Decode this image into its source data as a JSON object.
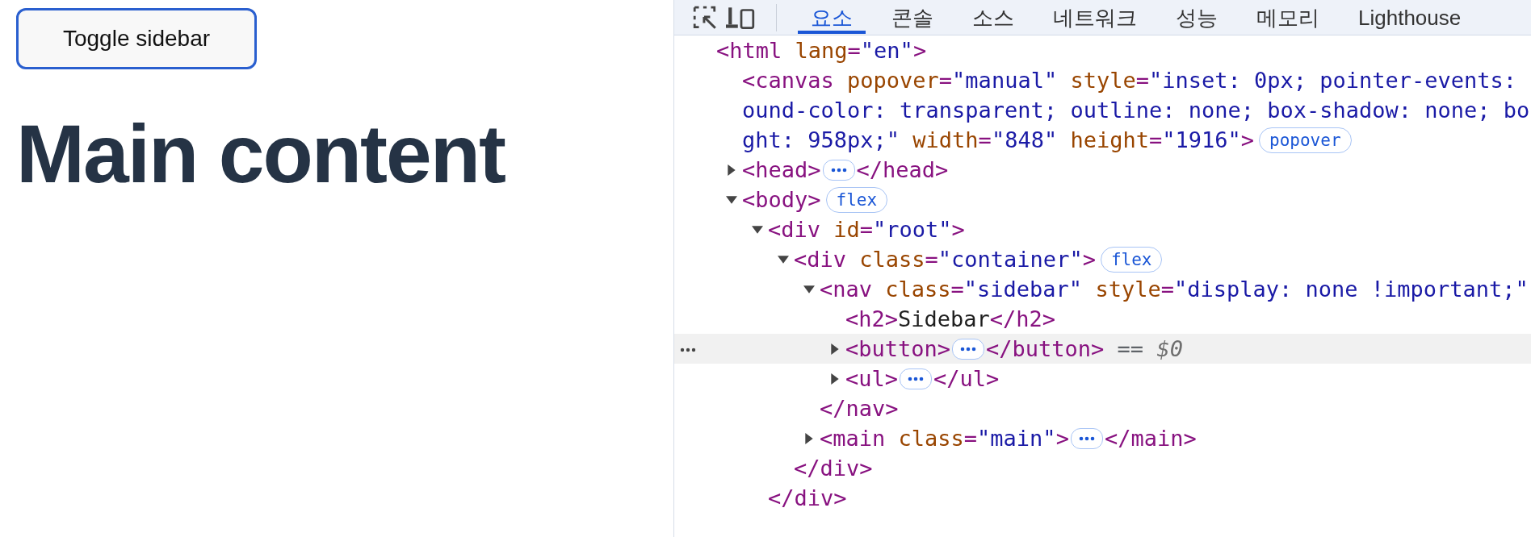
{
  "page": {
    "button": "Toggle sidebar",
    "heading": "Main content"
  },
  "devtools": {
    "tabs": [
      {
        "label": "요소",
        "selected": true
      },
      {
        "label": "콘솔",
        "selected": false
      },
      {
        "label": "소스",
        "selected": false
      },
      {
        "label": "네트워크",
        "selected": false
      },
      {
        "label": "성능",
        "selected": false
      },
      {
        "label": "메모리",
        "selected": false
      },
      {
        "label": "Lighthouse",
        "selected": false
      }
    ],
    "tree": [
      {
        "lines": [
          [
            {
              "kind": "tag",
              "text": "<html "
            },
            {
              "kind": "attr",
              "text": "lang"
            },
            {
              "kind": "tag",
              "text": "="
            },
            {
              "kind": "value",
              "text": "\"en\""
            },
            {
              "kind": "tag",
              "text": ">"
            }
          ]
        ],
        "children": [
          {
            "lines": [
              [
                {
                  "kind": "tag",
                  "text": "<canvas "
                },
                {
                  "kind": "attr",
                  "text": "popover"
                },
                {
                  "kind": "tag",
                  "text": "="
                },
                {
                  "kind": "value",
                  "text": "\"manual\" "
                },
                {
                  "kind": "attr",
                  "text": "style"
                },
                {
                  "kind": "tag",
                  "text": "="
                },
                {
                  "kind": "value",
                  "text": "\"inset: 0px; pointer-events: "
                }
              ],
              [
                {
                  "kind": "value",
                  "text": "ound-color: transparent; outline: none; box-shadow: none; bo"
                }
              ],
              [
                {
                  "kind": "value",
                  "text": "ght: 958px;\" "
                },
                {
                  "kind": "attr",
                  "text": "width"
                },
                {
                  "kind": "tag",
                  "text": "="
                },
                {
                  "kind": "value",
                  "text": "\"848\" "
                },
                {
                  "kind": "attr",
                  "text": "height"
                },
                {
                  "kind": "tag",
                  "text": "="
                },
                {
                  "kind": "value",
                  "text": "\"1916\""
                },
                {
                  "kind": "tag",
                  "text": ">"
                }
              ]
            ],
            "badge": "popover"
          },
          {
            "lines": [
              [
                {
                  "kind": "tag",
                  "text": "<head>"
                }
              ]
            ],
            "expanded": false,
            "close": [
              {
                "kind": "tag",
                "text": "</head>"
              }
            ]
          },
          {
            "lines": [
              [
                {
                  "kind": "tag",
                  "text": "<body>"
                }
              ]
            ],
            "badge": "flex",
            "expanded": true,
            "children": [
              {
                "lines": [
                  [
                    {
                      "kind": "tag",
                      "text": "<div "
                    },
                    {
                      "kind": "attr",
                      "text": "id"
                    },
                    {
                      "kind": "tag",
                      "text": "="
                    },
                    {
                      "kind": "value",
                      "text": "\"root\""
                    },
                    {
                      "kind": "tag",
                      "text": ">"
                    }
                  ]
                ],
                "expanded": true,
                "children": [
                  {
                    "lines": [
                      [
                        {
                          "kind": "tag",
                          "text": "<div "
                        },
                        {
                          "kind": "attr",
                          "text": "class"
                        },
                        {
                          "kind": "tag",
                          "text": "="
                        },
                        {
                          "kind": "value",
                          "text": "\"container\""
                        },
                        {
                          "kind": "tag",
                          "text": ">"
                        }
                      ]
                    ],
                    "badge": "flex",
                    "expanded": true,
                    "children": [
                      {
                        "lines": [
                          [
                            {
                              "kind": "tag",
                              "text": "<nav "
                            },
                            {
                              "kind": "attr",
                              "text": "class"
                            },
                            {
                              "kind": "tag",
                              "text": "="
                            },
                            {
                              "kind": "value",
                              "text": "\"sidebar\" "
                            },
                            {
                              "kind": "attr",
                              "text": "style"
                            },
                            {
                              "kind": "tag",
                              "text": "="
                            },
                            {
                              "kind": "value",
                              "text": "\"display: none !important;\""
                            }
                          ]
                        ],
                        "expanded": true,
                        "children": [
                          {
                            "lines": [
                              [
                                {
                                  "kind": "tag",
                                  "text": "<h2>"
                                },
                                {
                                  "kind": "text",
                                  "text": "Sidebar"
                                },
                                {
                                  "kind": "tag",
                                  "text": "</h2>"
                                }
                              ]
                            ]
                          },
                          {
                            "lines": [
                              [
                                {
                                  "kind": "tag",
                                  "text": "<button>"
                                }
                              ]
                            ],
                            "expanded": false,
                            "selected": true,
                            "close": [
                              {
                                "kind": "tag",
                                "text": "</button>"
                              },
                              {
                                "kind": "note",
                                "text": " == "
                              },
                              {
                                "kind": "var",
                                "text": "$0"
                              }
                            ]
                          },
                          {
                            "lines": [
                              [
                                {
                                  "kind": "tag",
                                  "text": "<ul>"
                                }
                              ]
                            ],
                            "expanded": false,
                            "selected": false,
                            "close": [
                              {
                                "kind": "tag",
                                "text": "</ul>"
                              }
                            ]
                          }
                        ],
                        "close": [
                          {
                            "kind": "tag",
                            "text": "</nav>"
                          }
                        ]
                      },
                      {
                        "lines": [
                          [
                            {
                              "kind": "tag",
                              "text": "<main "
                            },
                            {
                              "kind": "attr",
                              "text": "class"
                            },
                            {
                              "kind": "tag",
                              "text": "="
                            },
                            {
                              "kind": "value",
                              "text": "\"main\""
                            },
                            {
                              "kind": "tag",
                              "text": ">"
                            }
                          ]
                        ],
                        "expanded": false,
                        "close": [
                          {
                            "kind": "tag",
                            "text": "</main>"
                          }
                        ]
                      }
                    ],
                    "close": [
                      {
                        "kind": "tag",
                        "text": "</div>"
                      }
                    ]
                  }
                ],
                "close": [
                  {
                    "kind": "tag",
                    "text": "</div>"
                  }
                ]
              }
            ]
          }
        ]
      }
    ]
  }
}
